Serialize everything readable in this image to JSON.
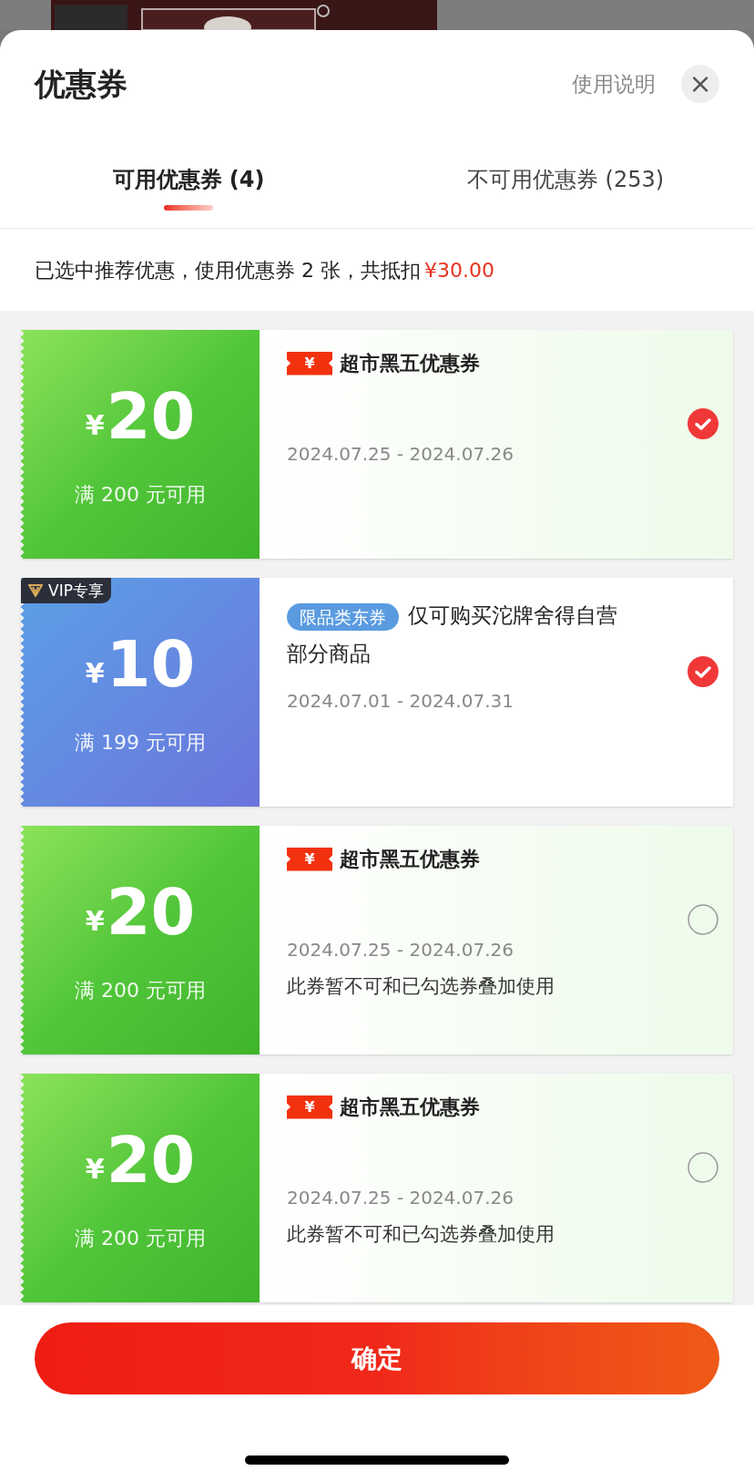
{
  "header": {
    "title": "优惠券",
    "help_link": "使用说明",
    "close": "×"
  },
  "tabs": [
    {
      "label": "可用优惠券 (4)",
      "selected": true
    },
    {
      "label": "不可用优惠券 (253)",
      "selected": false
    }
  ],
  "summary": {
    "text": "已选中推荐优惠，使用优惠券 2 张，共抵扣",
    "amount": "¥30.00"
  },
  "coupons": [
    {
      "kind": "green",
      "currency": "¥",
      "amount": "20",
      "condition": "满 200 元可用",
      "title_icon": "¥",
      "title": "超市黑五优惠券",
      "date": "2024.07.25 - 2024.07.26",
      "selected": true
    },
    {
      "kind": "blue",
      "badge": "VIP专享",
      "currency": "¥",
      "amount": "10",
      "condition": "满 199 元可用",
      "tag": "限品类东券",
      "title": "仅可购买沱牌舍得自营部分商品",
      "date": "2024.07.01 - 2024.07.31",
      "selected": true
    },
    {
      "kind": "green",
      "currency": "¥",
      "amount": "20",
      "condition": "满 200 元可用",
      "title_icon": "¥",
      "title": "超市黑五优惠券",
      "date": "2024.07.25 - 2024.07.26",
      "note": "此券暂不可和已勾选券叠加使用",
      "selected": false
    },
    {
      "kind": "green",
      "currency": "¥",
      "amount": "20",
      "condition": "满 200 元可用",
      "title_icon": "¥",
      "title": "超市黑五优惠券",
      "date": "2024.07.25 - 2024.07.26",
      "note": "此券暂不可和已勾选券叠加使用",
      "selected": false
    }
  ],
  "confirm_button": "确定"
}
